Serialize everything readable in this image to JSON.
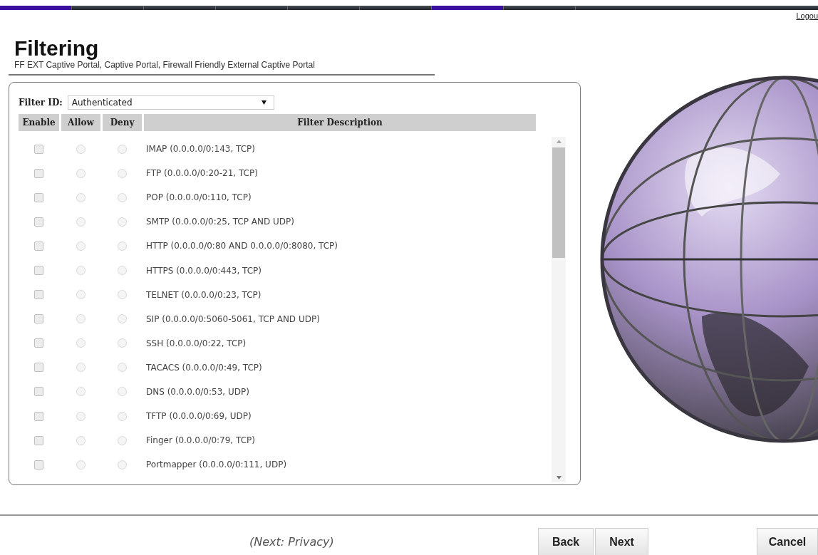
{
  "nav_tabs": [
    {
      "selected": true
    },
    {
      "selected": false
    },
    {
      "selected": false
    },
    {
      "selected": false
    },
    {
      "selected": false
    },
    {
      "selected": false
    },
    {
      "selected": true
    },
    {
      "selected": false
    }
  ],
  "logout_link": "Logou",
  "page": {
    "title": "Filtering",
    "subtitle": "FF EXT Captive Portal, Captive Portal, Firewall Friendly External Captive Portal"
  },
  "filter_id": {
    "label": "Filter ID:",
    "value": "Authenticated"
  },
  "table": {
    "columns": [
      "Enable",
      "Allow",
      "Deny",
      "Filter Description"
    ],
    "rows": [
      {
        "enabled": false,
        "allow": false,
        "deny": false,
        "disabled": true,
        "description": "IMAP (0.0.0.0/0:143, TCP)"
      },
      {
        "enabled": false,
        "allow": false,
        "deny": false,
        "disabled": true,
        "description": "FTP (0.0.0.0/0:20-21, TCP)"
      },
      {
        "enabled": false,
        "allow": false,
        "deny": false,
        "disabled": true,
        "description": "POP (0.0.0.0/0:110, TCP)"
      },
      {
        "enabled": false,
        "allow": false,
        "deny": false,
        "disabled": true,
        "description": "SMTP (0.0.0.0/0:25, TCP AND UDP)"
      },
      {
        "enabled": false,
        "allow": false,
        "deny": false,
        "disabled": true,
        "description": "HTTP (0.0.0.0/0:80 AND 0.0.0.0/0:8080, TCP)"
      },
      {
        "enabled": false,
        "allow": false,
        "deny": false,
        "disabled": true,
        "description": "HTTPS (0.0.0.0/0:443, TCP)"
      },
      {
        "enabled": false,
        "allow": false,
        "deny": false,
        "disabled": true,
        "description": "TELNET (0.0.0.0/0:23, TCP)"
      },
      {
        "enabled": false,
        "allow": false,
        "deny": false,
        "disabled": true,
        "description": "SIP (0.0.0.0/0:5060-5061, TCP AND UDP)"
      },
      {
        "enabled": false,
        "allow": false,
        "deny": false,
        "disabled": true,
        "description": "SSH (0.0.0.0/0:22, TCP)"
      },
      {
        "enabled": false,
        "allow": false,
        "deny": false,
        "disabled": true,
        "description": "TACACS (0.0.0.0/0:49, TCP)"
      },
      {
        "enabled": false,
        "allow": false,
        "deny": false,
        "disabled": true,
        "description": "DNS (0.0.0.0/0:53, UDP)"
      },
      {
        "enabled": false,
        "allow": false,
        "deny": false,
        "disabled": true,
        "description": "TFTP (0.0.0.0/0:69, UDP)"
      },
      {
        "enabled": false,
        "allow": false,
        "deny": false,
        "disabled": true,
        "description": "Finger (0.0.0.0/0:79, TCP)"
      },
      {
        "enabled": false,
        "allow": false,
        "deny": false,
        "disabled": true,
        "description": "Portmapper (0.0.0.0/0:111, UDP)"
      }
    ]
  },
  "footer": {
    "next_hint": "(Next: Privacy)",
    "buttons": [
      "Back",
      "Next",
      "Cancel"
    ]
  }
}
